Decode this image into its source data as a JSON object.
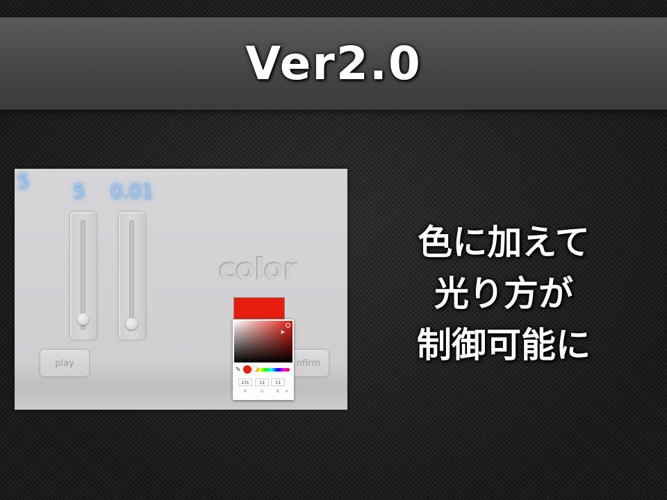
{
  "title": "Ver2.0",
  "caption": [
    "色に加えて",
    "光り方が",
    "制御可能に"
  ],
  "app": {
    "corner_value": "5",
    "slider1_value": "5",
    "slider2_value": "0.01",
    "slider1_level": 0.05,
    "slider2_level": 0.0,
    "color_label": "color",
    "play_label": "play",
    "confirm_label": "nfirm",
    "picker": {
      "swatch_color": "#e71d0d",
      "r": "231",
      "g": "13",
      "b": "13",
      "r_label": "R",
      "g_label": "G",
      "b_label": "B",
      "mode_label": "≡"
    }
  }
}
